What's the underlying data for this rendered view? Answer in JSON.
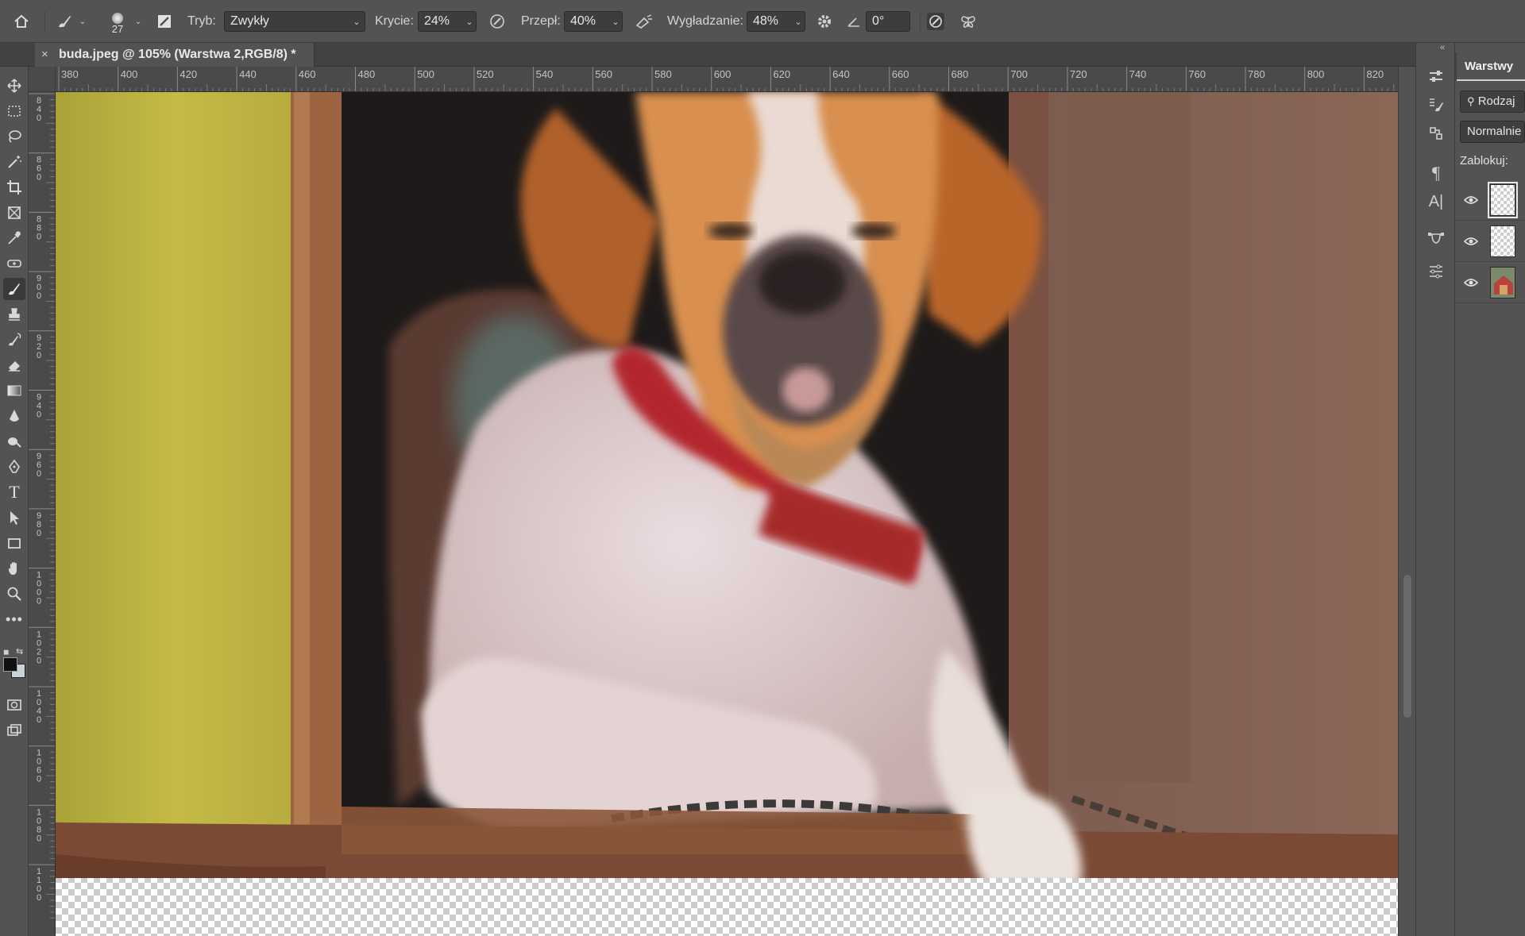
{
  "options_bar": {
    "brush_size": "27",
    "mode_label": "Tryb:",
    "mode_value": "Zwykły",
    "opacity_label": "Krycie:",
    "opacity_value": "24%",
    "flow_label": "Przepł:",
    "flow_value": "40%",
    "smoothing_label": "Wygładzanie:",
    "smoothing_value": "48%",
    "angle_value": "0°"
  },
  "document_tab": {
    "close_glyph": "×",
    "title": "buda.jpeg @ 105% (Warstwa 2,RGB/8) *"
  },
  "rulers": {
    "horizontal": [
      "380",
      "400",
      "420",
      "440",
      "460",
      "480",
      "500",
      "520",
      "540",
      "560",
      "580",
      "600",
      "620",
      "640",
      "660",
      "680",
      "700",
      "720",
      "740",
      "760",
      "780",
      "800",
      "820"
    ],
    "vertical": [
      "840",
      "860",
      "880",
      "900",
      "920",
      "940",
      "960",
      "980",
      "1000",
      "1020",
      "1040",
      "1060",
      "1080",
      "1100"
    ]
  },
  "toolbar": {
    "tools": [
      "move-tool",
      "marquee-tool",
      "lasso-tool",
      "magic-wand-tool",
      "crop-tool",
      "frame-tool",
      "eyedropper-tool",
      "spot-healing-tool",
      "brush-tool",
      "clone-stamp-tool",
      "history-brush-tool",
      "eraser-tool",
      "gradient-tool",
      "blur-tool",
      "dodge-tool",
      "pen-tool",
      "type-tool",
      "path-selection-tool",
      "rectangle-tool",
      "hand-tool",
      "zoom-tool",
      "more-tools"
    ],
    "active_tool": "brush-tool",
    "foreground_color": "#111111",
    "background_color": "#c9d2d6"
  },
  "layers_panel": {
    "tab_label": "Warstwy",
    "filter_label": "Rodzaj",
    "blend_mode": "Normalnie",
    "lock_label": "Zablokuj:",
    "layers": [
      {
        "visible": true,
        "selected": true,
        "thumb": "transparent"
      },
      {
        "visible": true,
        "selected": false,
        "thumb": "transparent"
      },
      {
        "visible": true,
        "selected": false,
        "thumb": "photo"
      }
    ]
  },
  "colors": {
    "ui_background": "#535353",
    "panel_dark": "#424242",
    "collar_red": "#b3262d"
  }
}
